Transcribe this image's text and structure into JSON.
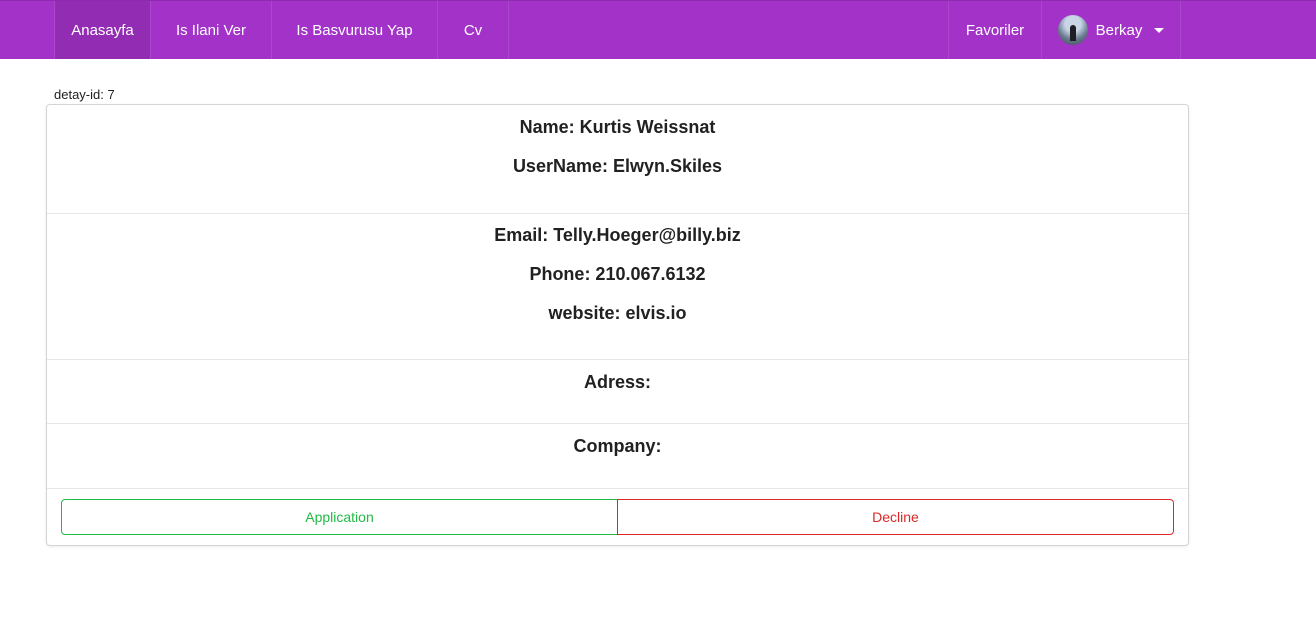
{
  "nav": {
    "home": "Anasayfa",
    "post_job": "Is Ilani Ver",
    "apply_job": "Is Basvurusu Yap",
    "cv": "Cv",
    "favorites": "Favoriler",
    "user_name": "Berkay"
  },
  "detail": {
    "id_label": "detay-id: 7"
  },
  "profile": {
    "name": "Name: Kurtis Weissnat",
    "username": "UserName: Elwyn.Skiles",
    "email": "Email: Telly.Hoeger@billy.biz",
    "phone": "Phone: 210.067.6132",
    "website": "website: elvis.io",
    "address": "Adress:",
    "company": "Company:"
  },
  "actions": {
    "application": "Application",
    "decline": "Decline"
  },
  "colors": {
    "navbar": "#a333c8",
    "application": "#21ba45",
    "decline": "#db2828"
  },
  "icons": {
    "avatar": "user-avatar",
    "dropdown": "caret-down-icon"
  }
}
